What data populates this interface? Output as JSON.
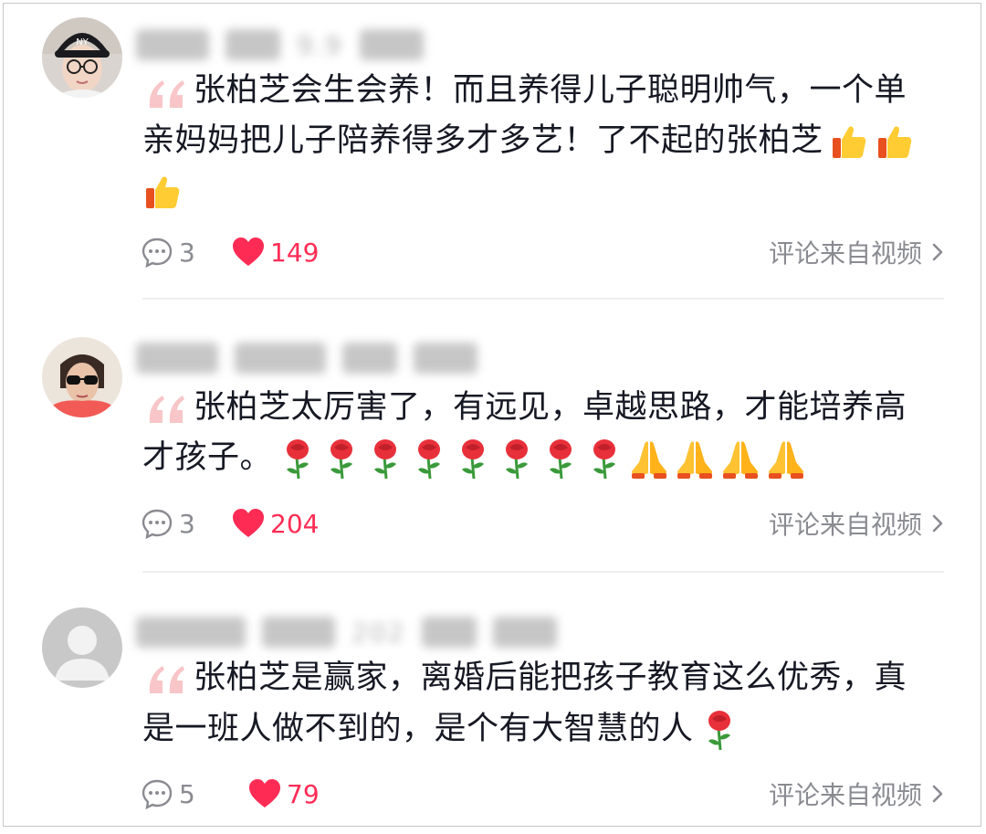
{
  "colors": {
    "like_red": "#fe2c55",
    "muted_gray": "#8a8b91",
    "text_dark": "#161823",
    "quote_pink": "#f8c6c8"
  },
  "comments": [
    {
      "avatar": "user-avatar-woman-cap",
      "username_visible": "9.9",
      "text_lines": [
        "张柏芝会生会养！而且养得儿子聪明帅气，一个单",
        "亲妈妈把儿子陪养得多才多艺！了不起的张柏芝",
        ""
      ],
      "emojis": [
        "thumbs-up-icon",
        "thumbs-up-icon",
        "thumbs-up-icon"
      ],
      "reply_count": "3",
      "like_count": "149",
      "source_label": "评论来自视频"
    },
    {
      "avatar": "user-avatar-woman-sunglasses",
      "username_visible": "",
      "text_lines": [
        "张柏芝太厉害了，有远见，卓越思路，才能培养高",
        "才孩子。"
      ],
      "emojis": [
        "rose-icon",
        "rose-icon",
        "rose-icon",
        "rose-icon",
        "rose-icon",
        "rose-icon",
        "rose-icon",
        "rose-icon",
        "pray-icon",
        "pray-icon",
        "pray-icon",
        "pray-icon"
      ],
      "reply_count": "3",
      "like_count": "204",
      "source_label": "评论来自视频"
    },
    {
      "avatar": "default-avatar",
      "username_visible": "202",
      "text_lines": [
        "张柏芝是赢家，离婚后能把孩子教育这么优秀，真",
        "是一班人做不到的，是个有大智慧的人"
      ],
      "emojis": [
        "rose-icon"
      ],
      "reply_count": "5",
      "like_count": "79",
      "source_label": "评论来自视频"
    }
  ]
}
